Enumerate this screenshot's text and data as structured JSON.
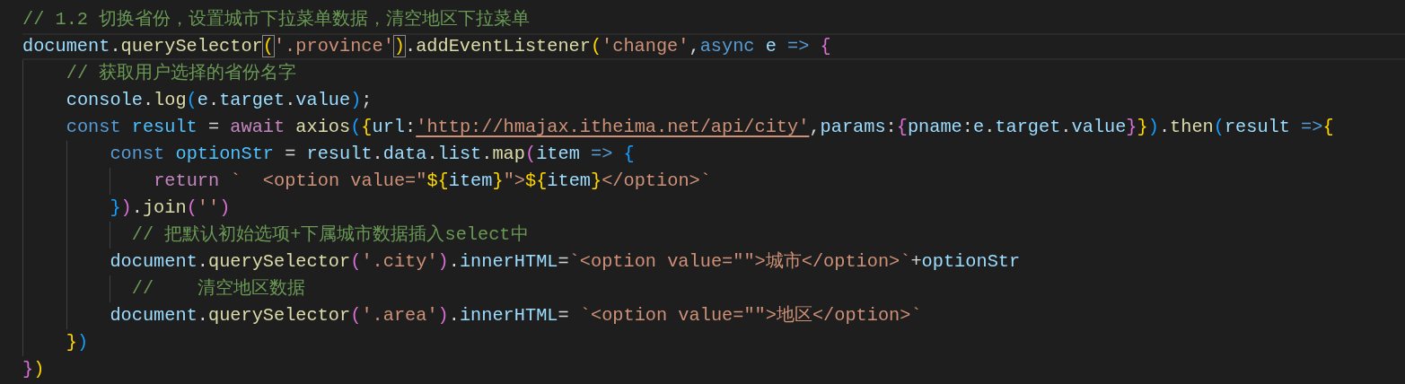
{
  "editor": {
    "lines": [
      {
        "current": false,
        "tokens": [
          {
            "text": "// 1.2 切换省份，设置城市下拉菜单数据，清空地区下拉菜单",
            "kind": "comment"
          }
        ]
      },
      {
        "current": true,
        "tokens": [
          {
            "text": "document",
            "kind": "var"
          },
          {
            "text": ".",
            "kind": "plain"
          },
          {
            "text": "querySelector",
            "kind": "fn"
          },
          {
            "text": "(",
            "kind": "bracket1",
            "matched": true
          },
          {
            "text": "'.province'",
            "kind": "string"
          },
          {
            "text": ")",
            "kind": "bracket1",
            "matched": true
          },
          {
            "text": ".",
            "kind": "plain"
          },
          {
            "text": "addEventListener",
            "kind": "fn"
          },
          {
            "text": "(",
            "kind": "bracket1"
          },
          {
            "text": "'change'",
            "kind": "string"
          },
          {
            "text": ",",
            "kind": "plain"
          },
          {
            "text": "async ",
            "kind": "keyword"
          },
          {
            "text": "e ",
            "kind": "var"
          },
          {
            "text": "=> ",
            "kind": "keyword"
          },
          {
            "text": "{",
            "kind": "bracket2"
          }
        ]
      },
      {
        "current": false,
        "tokens": [
          {
            "text": "    // 获取用户选择的省份名字",
            "kind": "comment"
          }
        ]
      },
      {
        "current": false,
        "tokens": [
          {
            "text": "    console",
            "kind": "var"
          },
          {
            "text": ".",
            "kind": "plain"
          },
          {
            "text": "log",
            "kind": "fn"
          },
          {
            "text": "(",
            "kind": "bracket3"
          },
          {
            "text": "e",
            "kind": "var"
          },
          {
            "text": ".",
            "kind": "plain"
          },
          {
            "text": "target",
            "kind": "var"
          },
          {
            "text": ".",
            "kind": "plain"
          },
          {
            "text": "value",
            "kind": "var"
          },
          {
            "text": ")",
            "kind": "bracket3"
          },
          {
            "text": ";",
            "kind": "plain"
          }
        ]
      },
      {
        "current": false,
        "tokens": [
          {
            "text": "    const ",
            "kind": "keyword"
          },
          {
            "text": "result",
            "kind": "const"
          },
          {
            "text": " = ",
            "kind": "plain"
          },
          {
            "text": "await ",
            "kind": "control"
          },
          {
            "text": "axios",
            "kind": "fn"
          },
          {
            "text": "(",
            "kind": "bracket3"
          },
          {
            "text": "{",
            "kind": "bracket1"
          },
          {
            "text": "url",
            "kind": "var"
          },
          {
            "text": ":",
            "kind": "plain"
          },
          {
            "text": "'http://hmajax.itheima.net/api/city'",
            "kind": "link"
          },
          {
            "text": ",",
            "kind": "plain"
          },
          {
            "text": "params",
            "kind": "var"
          },
          {
            "text": ":",
            "kind": "plain"
          },
          {
            "text": "{",
            "kind": "bracket2"
          },
          {
            "text": "pname",
            "kind": "var"
          },
          {
            "text": ":",
            "kind": "plain"
          },
          {
            "text": "e",
            "kind": "var"
          },
          {
            "text": ".",
            "kind": "plain"
          },
          {
            "text": "target",
            "kind": "var"
          },
          {
            "text": ".",
            "kind": "plain"
          },
          {
            "text": "value",
            "kind": "var"
          },
          {
            "text": "}",
            "kind": "bracket2"
          },
          {
            "text": "}",
            "kind": "bracket1"
          },
          {
            "text": ")",
            "kind": "bracket3"
          },
          {
            "text": ".",
            "kind": "plain"
          },
          {
            "text": "then",
            "kind": "fn"
          },
          {
            "text": "(",
            "kind": "bracket3"
          },
          {
            "text": "result ",
            "kind": "var"
          },
          {
            "text": "=>",
            "kind": "keyword"
          },
          {
            "text": "{",
            "kind": "bracket1"
          }
        ]
      },
      {
        "current": false,
        "tokens": [
          {
            "text": "        const ",
            "kind": "keyword"
          },
          {
            "text": "optionStr",
            "kind": "const"
          },
          {
            "text": " = ",
            "kind": "plain"
          },
          {
            "text": "result",
            "kind": "var"
          },
          {
            "text": ".",
            "kind": "plain"
          },
          {
            "text": "data",
            "kind": "var"
          },
          {
            "text": ".",
            "kind": "plain"
          },
          {
            "text": "list",
            "kind": "var"
          },
          {
            "text": ".",
            "kind": "plain"
          },
          {
            "text": "map",
            "kind": "fn"
          },
          {
            "text": "(",
            "kind": "bracket2"
          },
          {
            "text": "item ",
            "kind": "var"
          },
          {
            "text": "=> ",
            "kind": "keyword"
          },
          {
            "text": "{",
            "kind": "bracket3"
          }
        ]
      },
      {
        "current": false,
        "tokens": [
          {
            "text": "            return",
            "kind": "control"
          },
          {
            "text": " `  <option value=\"",
            "kind": "string"
          },
          {
            "text": "${",
            "kind": "bracket1"
          },
          {
            "text": "item",
            "kind": "var"
          },
          {
            "text": "}",
            "kind": "bracket1"
          },
          {
            "text": "\">",
            "kind": "string"
          },
          {
            "text": "${",
            "kind": "bracket1"
          },
          {
            "text": "item",
            "kind": "var"
          },
          {
            "text": "}",
            "kind": "bracket1"
          },
          {
            "text": "</option>`",
            "kind": "string"
          }
        ]
      },
      {
        "current": false,
        "tokens": [
          {
            "text": "        }",
            "kind": "bracket3"
          },
          {
            "text": ")",
            "kind": "bracket2"
          },
          {
            "text": ".",
            "kind": "plain"
          },
          {
            "text": "join",
            "kind": "fn"
          },
          {
            "text": "(",
            "kind": "bracket2"
          },
          {
            "text": "''",
            "kind": "string"
          },
          {
            "text": ")",
            "kind": "bracket2"
          }
        ]
      },
      {
        "current": false,
        "tokens": [
          {
            "text": "          // 把默认初始选项+下属城市数据插入select中",
            "kind": "comment"
          }
        ]
      },
      {
        "current": false,
        "tokens": [
          {
            "text": "        document",
            "kind": "var"
          },
          {
            "text": ".",
            "kind": "plain"
          },
          {
            "text": "querySelector",
            "kind": "fn"
          },
          {
            "text": "(",
            "kind": "bracket2"
          },
          {
            "text": "'.city'",
            "kind": "string"
          },
          {
            "text": ")",
            "kind": "bracket2"
          },
          {
            "text": ".",
            "kind": "plain"
          },
          {
            "text": "innerHTML",
            "kind": "var"
          },
          {
            "text": "=",
            "kind": "plain"
          },
          {
            "text": "`<option value=\"\">城市</option>`",
            "kind": "string"
          },
          {
            "text": "+",
            "kind": "plain"
          },
          {
            "text": "optionStr",
            "kind": "var"
          }
        ]
      },
      {
        "current": false,
        "tokens": [
          {
            "text": "          //    清空地区数据",
            "kind": "comment"
          }
        ]
      },
      {
        "current": false,
        "tokens": [
          {
            "text": "        document",
            "kind": "var"
          },
          {
            "text": ".",
            "kind": "plain"
          },
          {
            "text": "querySelector",
            "kind": "fn"
          },
          {
            "text": "(",
            "kind": "bracket2"
          },
          {
            "text": "'.area'",
            "kind": "string"
          },
          {
            "text": ")",
            "kind": "bracket2"
          },
          {
            "text": ".",
            "kind": "plain"
          },
          {
            "text": "innerHTML",
            "kind": "var"
          },
          {
            "text": "= ",
            "kind": "plain"
          },
          {
            "text": "`<option value=\"\">地区</option>`",
            "kind": "string"
          }
        ]
      },
      {
        "current": false,
        "tokens": [
          {
            "text": "    }",
            "kind": "bracket1"
          },
          {
            "text": ")",
            "kind": "bracket3"
          }
        ]
      },
      {
        "current": false,
        "tokens": [
          {
            "text": "}",
            "kind": "bracket2"
          },
          {
            "text": ")",
            "kind": "bracket1"
          }
        ]
      }
    ]
  }
}
